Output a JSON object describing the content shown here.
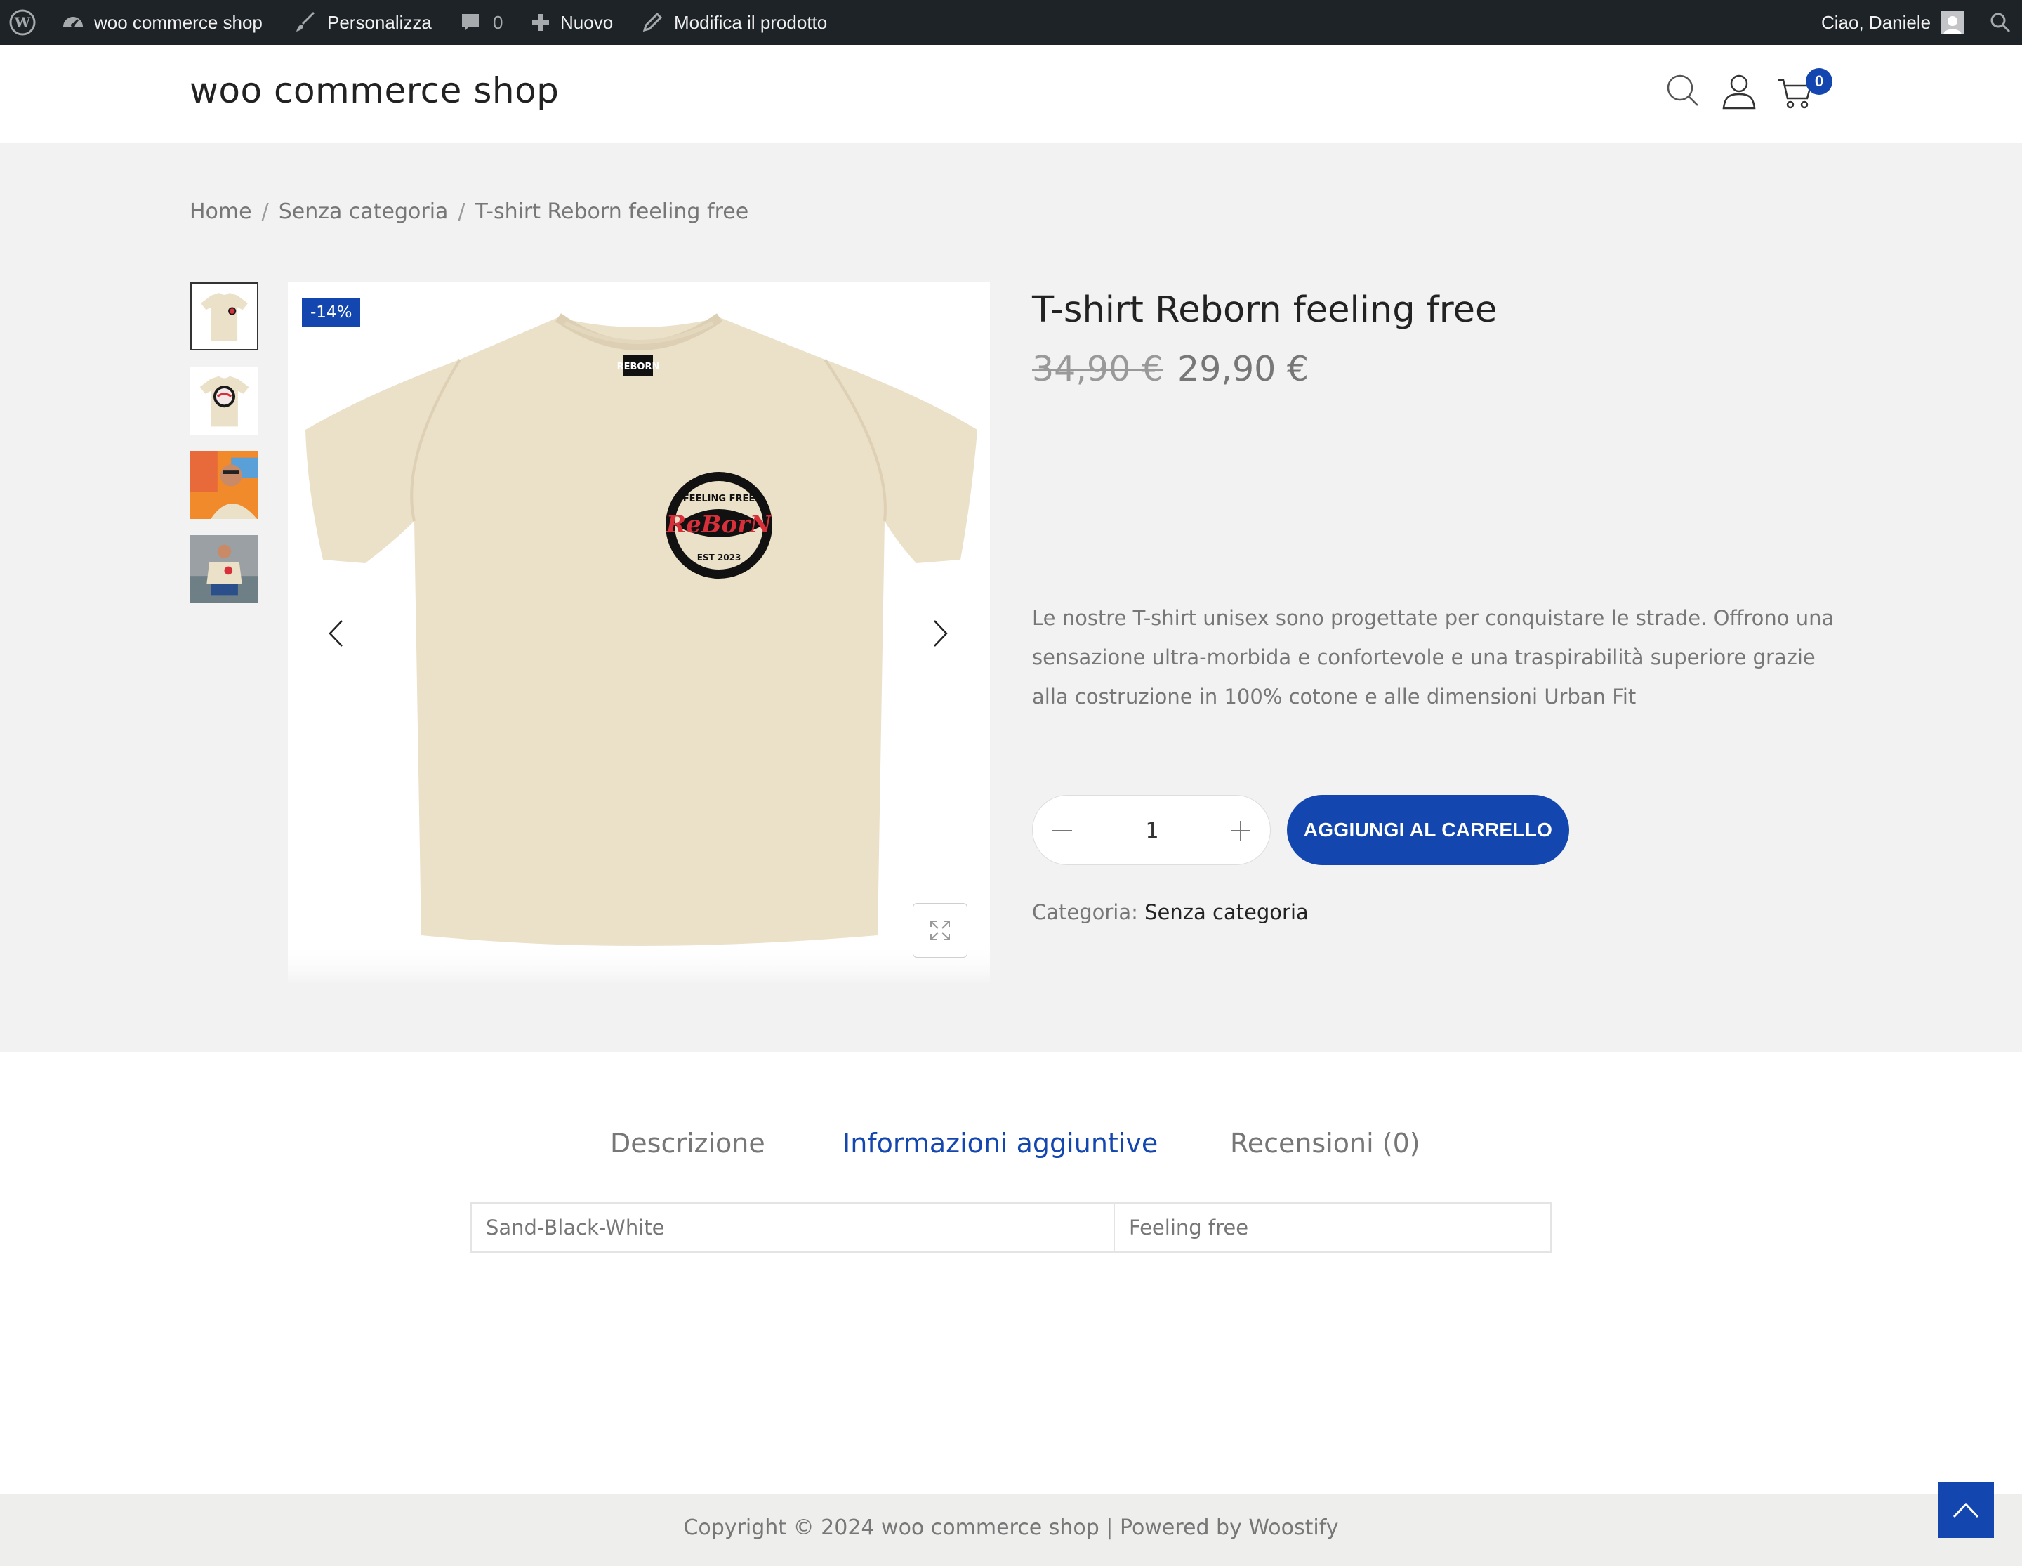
{
  "admin_bar": {
    "site_name": "woo commerce shop",
    "customize": "Personalizza",
    "comments_count": "0",
    "new": "Nuovo",
    "edit_product": "Modifica il prodotto",
    "greeting": "Ciao, Daniele"
  },
  "header": {
    "site_title": "woo commerce shop",
    "cart_count": "0"
  },
  "breadcrumb": {
    "home": "Home",
    "category": "Senza categoria",
    "current": "T-shirt Reborn feeling free",
    "separator": "/"
  },
  "product": {
    "title": "T-shirt Reborn feeling free",
    "sale_badge": "-14%",
    "old_price": "34,90 €",
    "price": "29,90 €",
    "description": "Le nostre T-shirt unisex sono progettate per conquistare le strade. Offrono una sensazione ultra-morbida e confortevole e una traspirabilità superiore grazie alla costruzione in 100% cotone e alle dimensioni Urban Fit",
    "quantity": "1",
    "add_to_cart": "AGGIUNGI AL CARRELLO",
    "category_label": "Categoria:",
    "category_value": "Senza categoria",
    "gallery_count": 4,
    "active_thumb": 1
  },
  "tabs": {
    "items": [
      {
        "label": "Descrizione"
      },
      {
        "label": "Informazioni aggiuntive"
      },
      {
        "label": "Recensioni (0)"
      }
    ],
    "active": 1
  },
  "additional_info": {
    "color": "Sand-Black-White",
    "design": "Feeling free"
  },
  "footer": {
    "text": "Copyright © 2024 woo commerce shop | Powered by Woostify"
  },
  "colors": {
    "accent": "#1346af",
    "admin_bar": "#1d2327",
    "shirt": "#ebe0c8"
  }
}
